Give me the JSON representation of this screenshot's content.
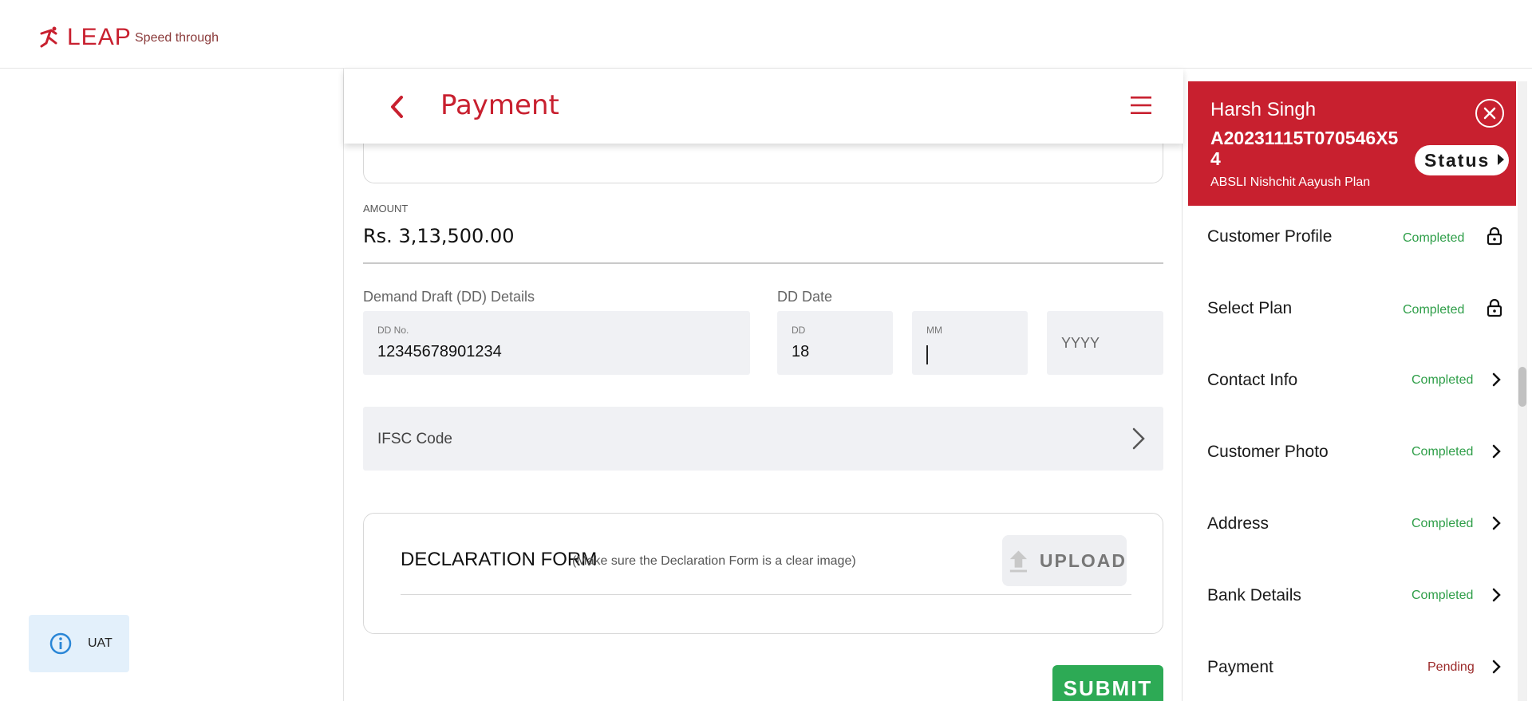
{
  "header": {
    "logo_text": "LEAP",
    "tagline": "Speed through"
  },
  "env_badge": {
    "label": "UAT",
    "icon": "info-icon"
  },
  "page": {
    "title": "Payment",
    "back_icon": "chevron-left-icon",
    "menu_icon": "hamburger-menu-icon"
  },
  "amount": {
    "label": "AMOUNT",
    "value": "Rs. 3,13,500.00"
  },
  "dd_details": {
    "section_label": "Demand Draft (DD) Details",
    "dd_no_label": "DD No.",
    "dd_no_value": "12345678901234"
  },
  "dd_date": {
    "section_label": "DD Date",
    "day_label": "DD",
    "day_value": "18",
    "month_label": "MM",
    "month_value": "",
    "year_placeholder": "YYYY"
  },
  "ifsc": {
    "label": "IFSC Code"
  },
  "declaration": {
    "title": "DECLARATION FORM",
    "hint": "(Make sure the Declaration Form is a clear image)",
    "upload_label": "UPLOAD"
  },
  "submit_label": "SUBMIT",
  "customer": {
    "name": "Harsh Singh",
    "application_id": "A20231115T070546X54",
    "plan": "ABSLI Nishchit Aayush Plan",
    "status_label": "Status"
  },
  "steps": [
    {
      "name": "Customer Profile",
      "status": "Completed",
      "icon": "lock-icon"
    },
    {
      "name": "Select Plan",
      "status": "Completed",
      "icon": "lock-icon"
    },
    {
      "name": "Contact Info",
      "status": "Completed",
      "icon": "chevron-right-icon"
    },
    {
      "name": "Customer Photo",
      "status": "Completed",
      "icon": "chevron-right-icon"
    },
    {
      "name": "Address",
      "status": "Completed",
      "icon": "chevron-right-icon"
    },
    {
      "name": "Bank Details",
      "status": "Completed",
      "icon": "chevron-right-icon"
    },
    {
      "name": "Payment",
      "status": "Pending",
      "icon": "chevron-right-icon"
    }
  ],
  "colors": {
    "brand": "#c8202f",
    "completed": "#2e9e48",
    "pending": "#9b2a2a",
    "submit": "#2daa55"
  }
}
